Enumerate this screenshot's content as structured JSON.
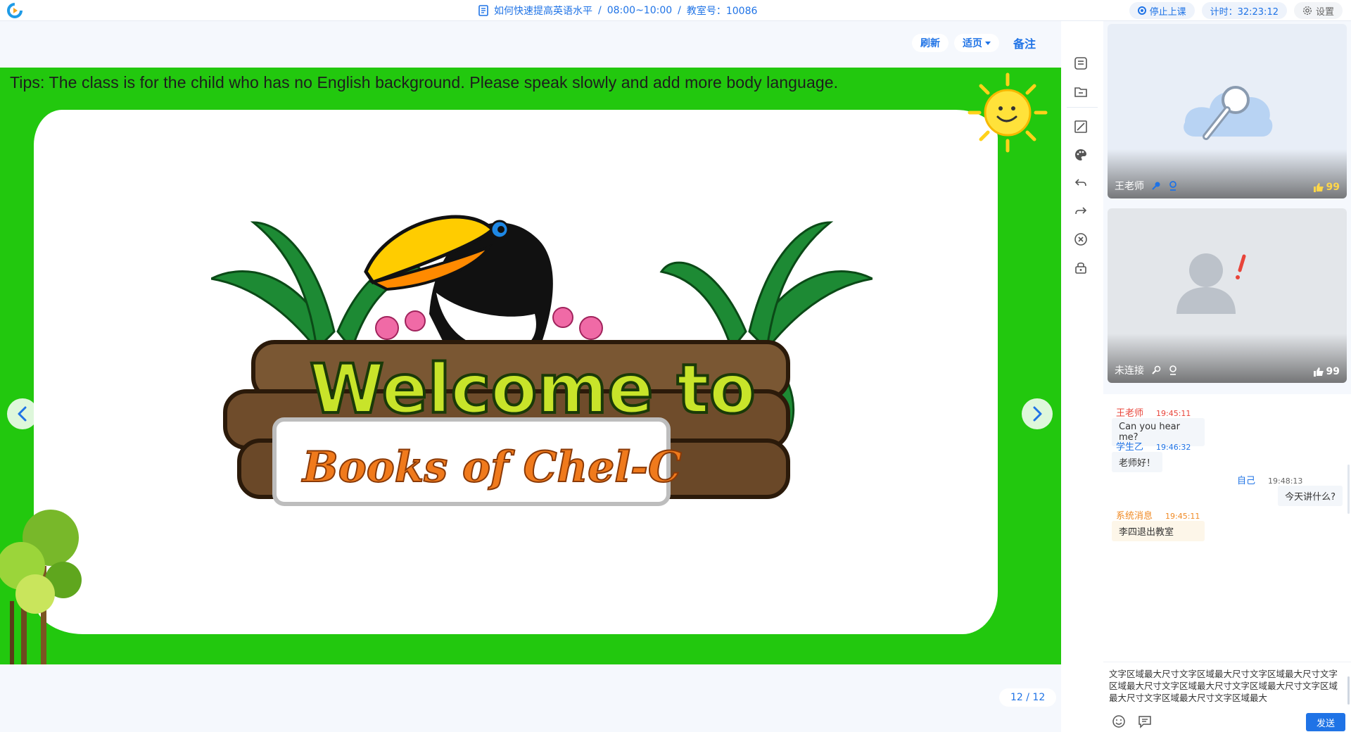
{
  "header": {
    "course_title": "如何快速提高英语水平",
    "time_range": "08:00~10:00",
    "room_label": "教室号：10086",
    "stop_class_label": "停止上课",
    "timer_label": "计时：32:23:12",
    "settings_label": "设置"
  },
  "stage": {
    "toolbar": {
      "refresh_label": "刷新",
      "fit_label": "适页",
      "notes_label": "备注"
    },
    "slide": {
      "tips_text": "Tips: The class is for the child who has no English background. Please speak slowly and add more body language.",
      "title_line1": "Welcome to",
      "title_line2": "Books of Chel-C"
    },
    "page_counter": "12 / 12"
  },
  "tools": [
    {
      "name": "courseware-list-icon"
    },
    {
      "name": "folder-icon"
    },
    {
      "name": "pen-icon"
    },
    {
      "name": "palette-icon"
    },
    {
      "name": "undo-icon"
    },
    {
      "name": "redo-icon"
    },
    {
      "name": "clear-icon"
    },
    {
      "name": "lock-icon"
    }
  ],
  "videos": {
    "teacher": {
      "name": "王老师",
      "likes": "99"
    },
    "student": {
      "name": "未连接",
      "likes": "99"
    }
  },
  "chat": {
    "messages": [
      {
        "sender": "王老师",
        "time": "19:45:11",
        "text": "Can you hear me?"
      },
      {
        "sender": "学生乙",
        "time": "19:46:32",
        "text": "老师好！"
      },
      {
        "sender": "自己",
        "time": "19:48:13",
        "text": "今天讲什么?"
      },
      {
        "sender": "系统消息",
        "time": "19:45:11",
        "text": "李四退出教室"
      }
    ],
    "input_value": "文字区域最大尺寸文字区域最大尺寸文字区域最大尺寸文字区域最大尺寸文字区域最大尺寸文字区域最大尺寸文字区域最大尺寸文字区域最大尺寸文字区域最大",
    "send_label": "发送"
  },
  "colors": {
    "accent": "#1f73e6",
    "teacher_name": "#e8443a",
    "student_name": "#1f73e6",
    "system_name": "#f08a24",
    "slide_green": "#22c80e"
  }
}
